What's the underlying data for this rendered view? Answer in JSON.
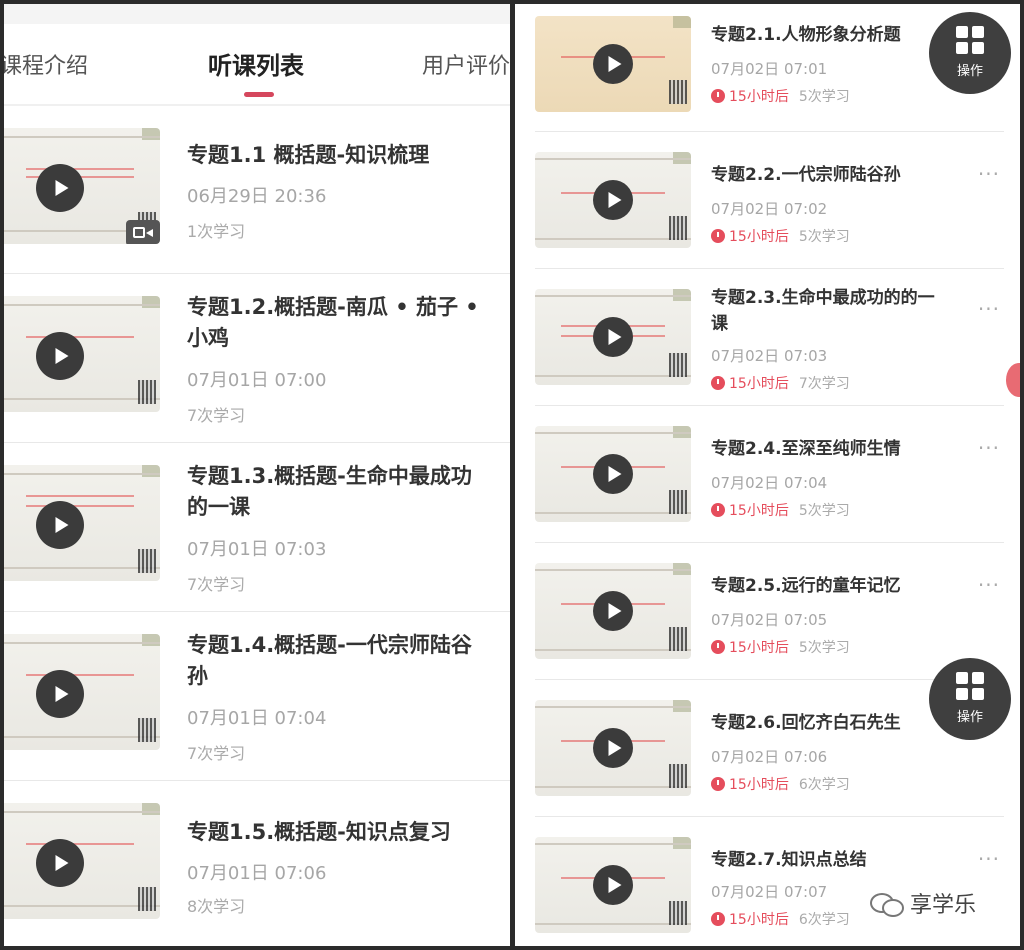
{
  "tabs": [
    "课程介绍",
    "听课列表",
    "用户评价"
  ],
  "active_tab_index": 1,
  "left_items": [
    {
      "title": "专题1.1 概括题-知识梳理",
      "date": "06月29日 20:36",
      "count": "1次学习",
      "has_video_badge": true
    },
    {
      "title": "专题1.2.概括题-南瓜 • 茄子 • 小鸡",
      "date": "07月01日 07:00",
      "count": "7次学习"
    },
    {
      "title": "专题1.3.概括题-生命中最成功的一课",
      "date": "07月01日 07:03",
      "count": "7次学习"
    },
    {
      "title": "专题1.4.概括题-一代宗师陆谷孙",
      "date": "07月01日 07:04",
      "count": "7次学习"
    },
    {
      "title": "专题1.5.概括题-知识点复习",
      "date": "07月01日 07:06",
      "count": "8次学习"
    }
  ],
  "right_items": [
    {
      "title": "专题2.1.人物形象分析题",
      "date": "07月02日 07:01",
      "remaining": "15小时后",
      "count": "5次学习"
    },
    {
      "title": "专题2.2.一代宗师陆谷孙",
      "date": "07月02日 07:02",
      "remaining": "15小时后",
      "count": "5次学习"
    },
    {
      "title": "专题2.3.生命中最成功的的一课",
      "date": "07月02日 07:03",
      "remaining": "15小时后",
      "count": "7次学习"
    },
    {
      "title": "专题2.4.至深至纯师生情",
      "date": "07月02日 07:04",
      "remaining": "15小时后",
      "count": "5次学习"
    },
    {
      "title": "专题2.5.远行的童年记忆",
      "date": "07月02日 07:05",
      "remaining": "15小时后",
      "count": "5次学习"
    },
    {
      "title": "专题2.6.回忆齐白石先生",
      "date": "07月02日 07:06",
      "remaining": "15小时后",
      "count": "6次学习"
    },
    {
      "title": "专题2.7.知识点总结",
      "date": "07月02日 07:07",
      "remaining": "15小时后",
      "count": "6次学习"
    }
  ],
  "ops_label": "操作",
  "more_symbol": "···",
  "watermark": "享学乐",
  "colors": {
    "accent": "#d5475d",
    "alarm": "#e54d5c",
    "play_button": "#3b3b3b"
  }
}
